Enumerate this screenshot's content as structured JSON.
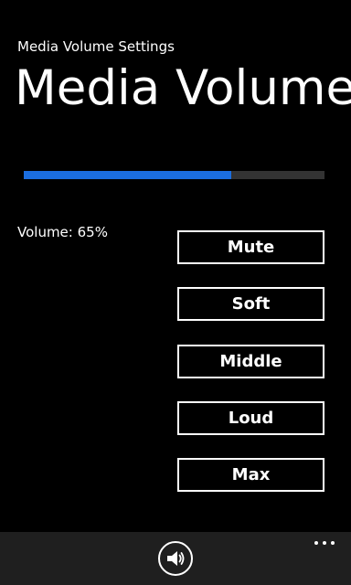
{
  "header": {
    "app_title": "Media Volume Settings",
    "page_title": "Media Volume"
  },
  "volume": {
    "label": "Volume: 65%",
    "percent": 65,
    "progress_fraction": 0.69,
    "fill_color": "#1b6ee0",
    "track_color": "#333333"
  },
  "buttons": {
    "mute": "Mute",
    "soft": "Soft",
    "middle": "Middle",
    "loud": "Loud",
    "max": "Max"
  },
  "app_bar": {
    "background_color": "#1f1f1f",
    "icon": "speaker-volume-icon",
    "menu_icon": "ellipsis-icon"
  }
}
